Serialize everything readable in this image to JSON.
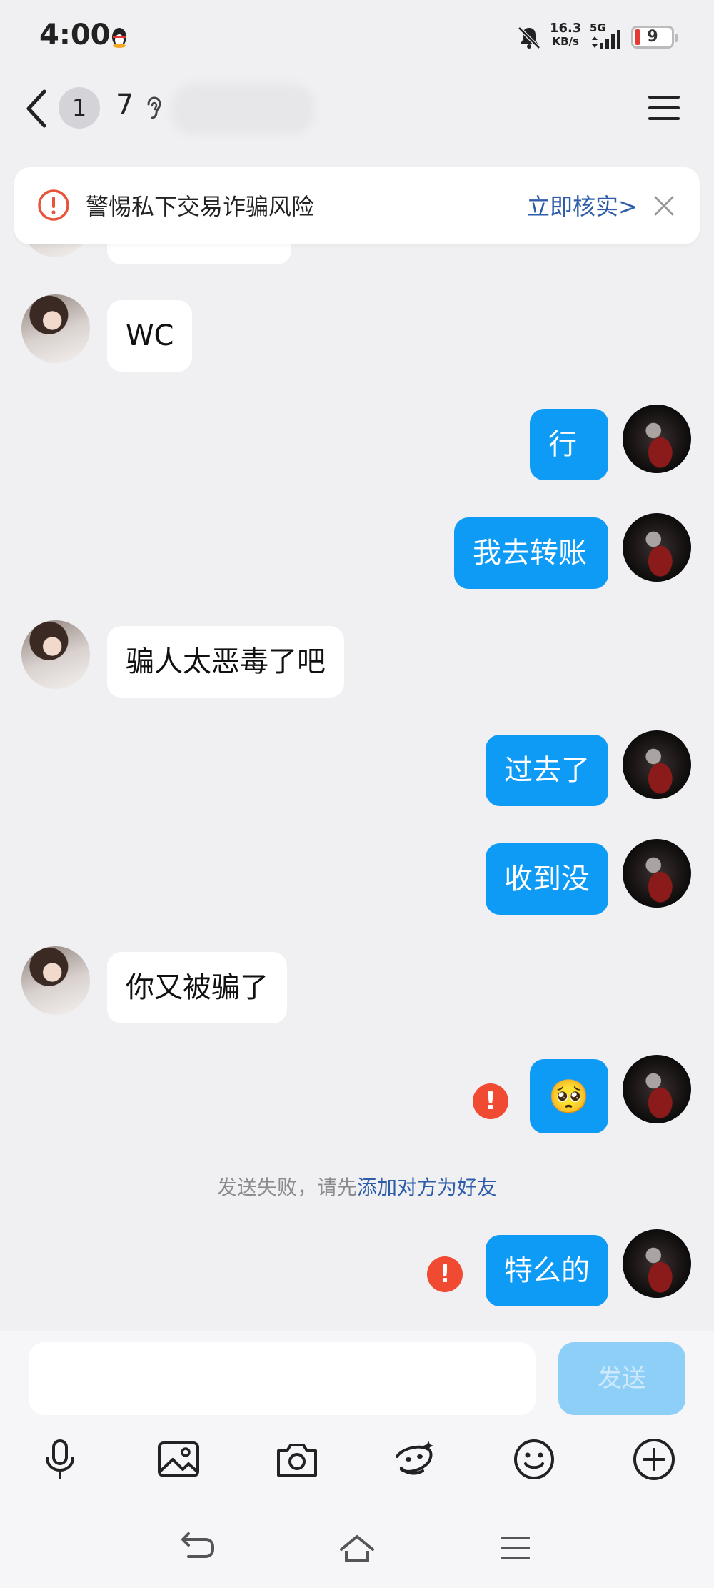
{
  "status_bar": {
    "time": "4:00",
    "net_speed": "16.3",
    "net_unit": "KB/s",
    "signal_label": "5G",
    "battery": "9"
  },
  "header": {
    "unread_badge": "1",
    "title": "7"
  },
  "banner": {
    "text": "警惕私下交易诈骗风险",
    "link": "立即核实>"
  },
  "messages": [
    {
      "side": "in",
      "text": "WC"
    },
    {
      "side": "out",
      "text": "行"
    },
    {
      "side": "out",
      "text": "我去转账"
    },
    {
      "side": "in",
      "text": "骗人太恶毒了吧"
    },
    {
      "side": "out",
      "text": "过去了"
    },
    {
      "side": "out",
      "text": "收到没"
    },
    {
      "side": "in",
      "text": "你又被骗了"
    },
    {
      "side": "out",
      "text": "🥺",
      "error": "!"
    },
    {
      "side": "out",
      "text": "特么的",
      "error": "!"
    }
  ],
  "system_note": {
    "prefix": "发送失败，请先",
    "link": "添加对方为好友"
  },
  "composer": {
    "input_value": "",
    "send_label": "发送"
  },
  "toolbar_icons": [
    "microphone-icon",
    "image-icon",
    "camera-icon",
    "hongbao-icon",
    "emoji-icon",
    "plus-icon"
  ],
  "nav_icons": [
    "back-nav-icon",
    "home-nav-icon",
    "recent-apps-icon"
  ],
  "colors": {
    "accent": "#0e9bf5",
    "link": "#2d5ca8",
    "error": "#f04a32",
    "background": "#f0f0f2"
  }
}
